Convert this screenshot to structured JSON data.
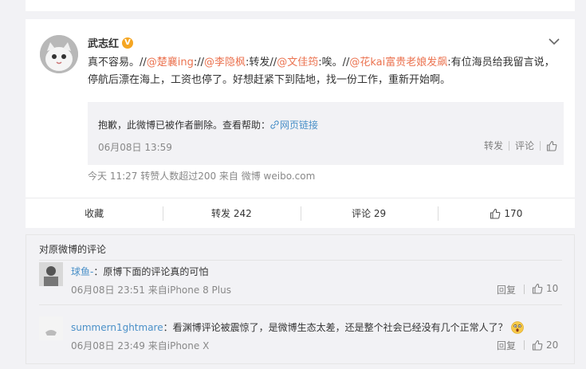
{
  "post": {
    "author": "武志红",
    "verified_badge": "V",
    "text_plain_1": "真不容易。//",
    "mention_1": "@楚襄ing",
    "text_plain_2": ":",
    "sep_2": "//",
    "mention_2": "@李隐枫",
    "text_plain_3": ":转发//",
    "mention_3": "@文佳筠",
    "text_plain_4": ":唉。//",
    "mention_4": "@花kai富贵老娘发飙",
    "text_plain_5": ":有位海员给我留言说，停航后漂在海上，工资也停了。好想赶紧下到陆地，找一份工作，重新开始啊。",
    "repost": {
      "deleted_message": "抱歉，此微博已被作者删除。查看帮助：",
      "link_label": "网页链接",
      "time": "06月08日 13:59",
      "forward_label": "转发",
      "comment_label": "评论"
    },
    "meta": "今天 11:27 转赞人数超过200  来自 微博 weibo.com"
  },
  "actions": {
    "collect": "收藏",
    "forward": "转发 242",
    "comment": "评论 29",
    "like": "170"
  },
  "comments": {
    "title": "对原微博的评论",
    "items": [
      {
        "user": "球鱼-",
        "text": "：原博下面的评论真的可怕",
        "meta": "06月08日 23:51 来自iPhone 8 Plus",
        "reply": "回复",
        "likes": "10"
      },
      {
        "user": "summern1ghtmare",
        "text": "：看渊博评论被震惊了，是微博生态太差，还是整个社会已经没有几个正常人了？",
        "meta": "06月08日 23:49 来自iPhone X",
        "reply": "回复",
        "likes": "20"
      }
    ]
  },
  "colors": {
    "accent": "#eb7350",
    "link": "#4a90c8",
    "verified": "#f5a623"
  }
}
